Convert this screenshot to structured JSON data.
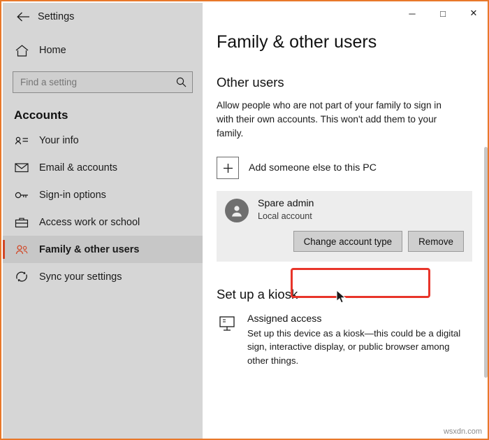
{
  "window": {
    "title": "Settings",
    "controls": {
      "minimize": "─",
      "maximize": "□",
      "close": "✕"
    }
  },
  "sidebar": {
    "back_label": "←",
    "home_label": "Home",
    "search": {
      "placeholder": "Find a setting",
      "value": ""
    },
    "section": "Accounts",
    "items": [
      {
        "label": "Your info",
        "icon": "person-card-icon",
        "selected": false
      },
      {
        "label": "Email & accounts",
        "icon": "envelope-icon",
        "selected": false
      },
      {
        "label": "Sign-in options",
        "icon": "key-icon",
        "selected": false
      },
      {
        "label": "Access work or school",
        "icon": "briefcase-icon",
        "selected": false
      },
      {
        "label": "Family & other users",
        "icon": "people-icon",
        "selected": true
      },
      {
        "label": "Sync your settings",
        "icon": "sync-icon",
        "selected": false
      }
    ]
  },
  "main": {
    "page_title": "Family & other users",
    "other_users": {
      "heading": "Other users",
      "description": "Allow people who are not part of your family to sign in with their own accounts. This won't add them to your family.",
      "add_user_label": "Add someone else to this PC",
      "account": {
        "name": "Spare admin",
        "type": "Local account",
        "change_button": "Change account type",
        "remove_button": "Remove"
      }
    },
    "kiosk": {
      "heading": "Set up a kiosk",
      "title": "Assigned access",
      "description": "Set up this device as a kiosk—this could be a digital sign, interactive display, or public browser among other things."
    }
  },
  "watermark": "wsxdn.com",
  "colors": {
    "accent": "#d24726",
    "highlight": "#e8352a",
    "frame": "#e8782a",
    "sidebar_bg": "#d6d6d6",
    "card_bg": "#ededed"
  }
}
